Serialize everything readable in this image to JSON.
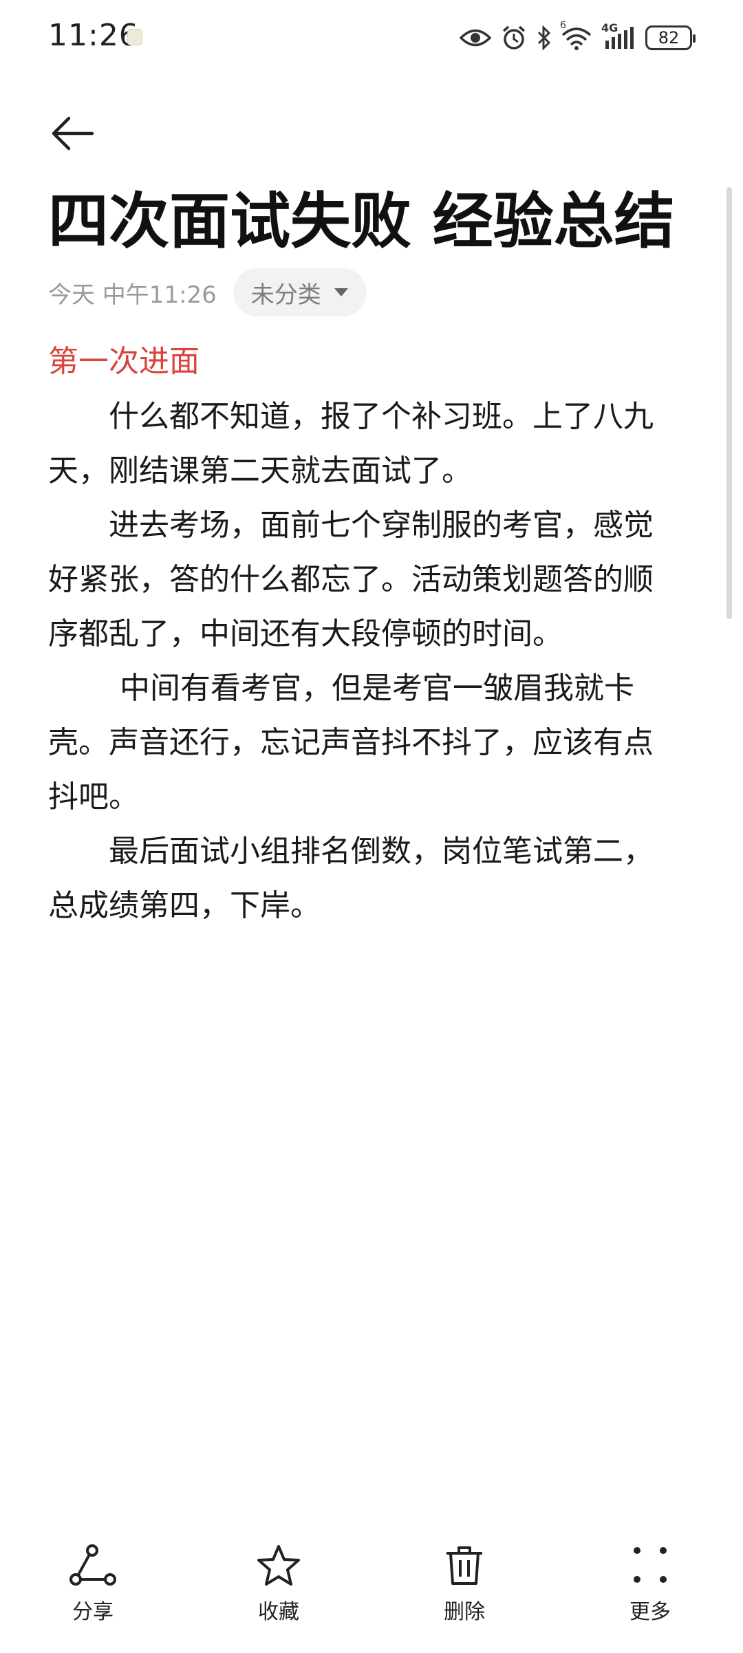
{
  "status_bar": {
    "time": "11:26",
    "battery": "82",
    "network": "4G",
    "wifi_badge": "6"
  },
  "note": {
    "title": "四次面试失败 经验总结",
    "date": "今天 中午11:26",
    "category": "未分类",
    "section_heading": "第一次进面",
    "paragraphs": [
      "什么都不知道，报了个补习班。上了八九天，刚结课第二天就去面试了。",
      "进去考场，面前七个穿制服的考官，感觉好紧张，答的什么都忘了。活动策划题答的顺序都乱了，中间还有大段停顿的时间。",
      "中间有看考官，但是考官一皱眉我就卡壳。声音还行，忘记声音抖不抖了，应该有点抖吧。",
      "最后面试小组排名倒数，岗位笔试第二，总成绩第四，下岸。"
    ]
  },
  "toolbar": {
    "share_label": "分享",
    "favorite_label": "收藏",
    "delete_label": "删除",
    "more_label": "更多"
  },
  "colors": {
    "accent_red": "#d9443d",
    "meta_gray": "#9a9a9a",
    "chip_bg": "#f2f2f2"
  }
}
